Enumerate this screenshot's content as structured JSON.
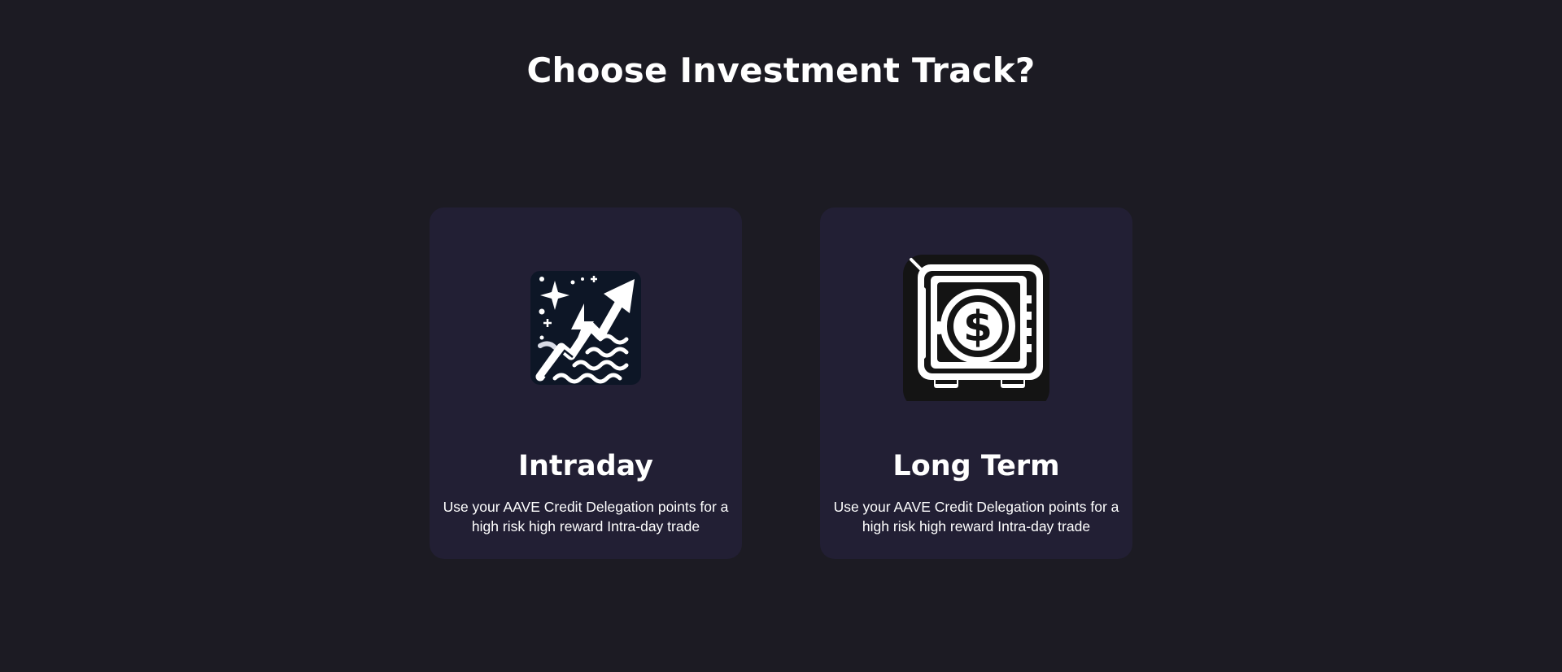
{
  "page": {
    "title": "Choose Investment Track?"
  },
  "tracks": [
    {
      "icon": "intraday-trend-icon",
      "title": "Intraday",
      "description": "Use your AAVE Credit Delegation points for a high risk high reward Intra-day trade"
    },
    {
      "icon": "vault-dollar-icon",
      "title": "Long Term",
      "description": "Use your AAVE Credit Delegation points for a high risk high reward Intra-day trade"
    }
  ],
  "colors": {
    "background": "#1c1b23",
    "card": "#221f34",
    "text": "#ffffff"
  }
}
